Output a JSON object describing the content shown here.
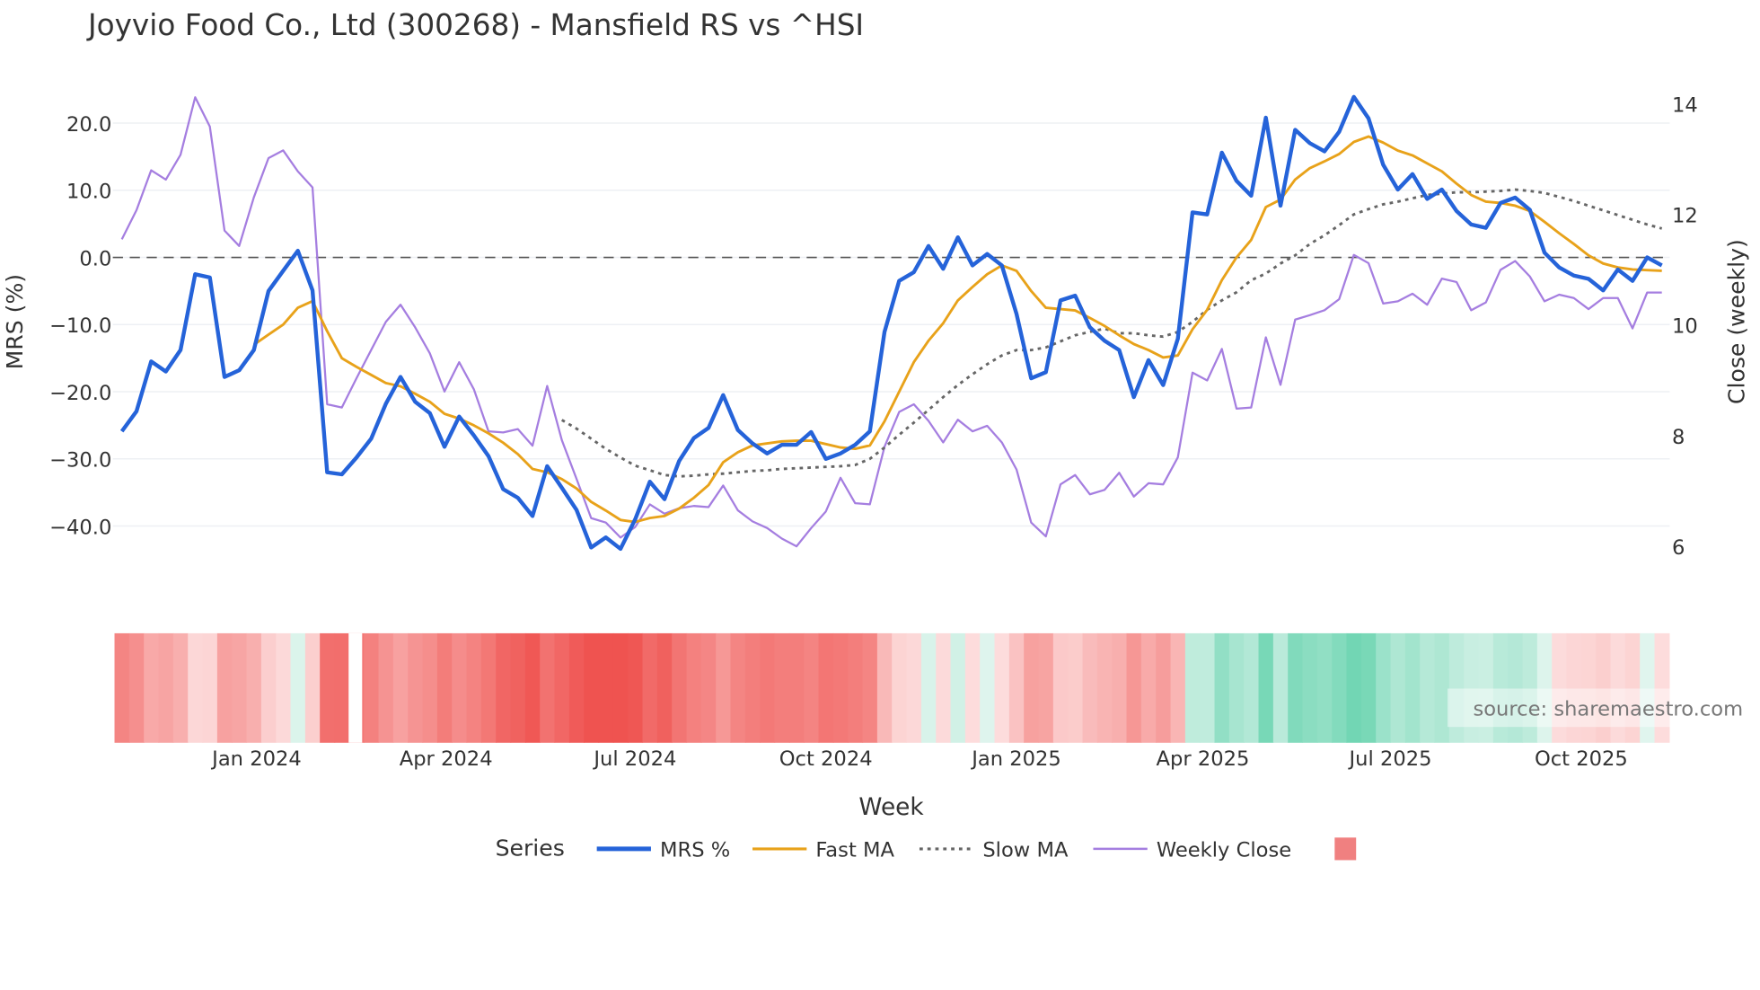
{
  "chart_data": {
    "type": "line",
    "title": "Joyvio Food Co., Ltd (300268) - Mansfield RS vs ^HSI",
    "xlabel": "Week",
    "ylabel_left": "MRS (%)",
    "ylabel_right": "Close (weekly)",
    "ylim_left": [
      -47,
      27
    ],
    "ylim_right": [
      5.4,
      14.6
    ],
    "yticks_left": [
      "20.0",
      "10.0",
      "0.0",
      "−10.0",
      "−20.0",
      "−30.0",
      "−40.0"
    ],
    "yticks_left_values": [
      20,
      10,
      0,
      -10,
      -20,
      -30,
      -40
    ],
    "yticks_right": [
      "14",
      "12",
      "10",
      "8",
      "6"
    ],
    "yticks_right_values": [
      14,
      12,
      10,
      8,
      6
    ],
    "x_ticks": [
      {
        "label": "Jan 2024",
        "week_index": 9.2
      },
      {
        "label": "Apr 2024",
        "week_index": 22.1
      },
      {
        "label": "Jul 2024",
        "week_index": 35
      },
      {
        "label": "Oct 2024",
        "week_index": 48
      },
      {
        "label": "Jan 2025",
        "week_index": 61
      },
      {
        "label": "Apr 2025",
        "week_index": 73.7
      },
      {
        "label": "Jul 2025",
        "week_index": 86.5
      },
      {
        "label": "Oct 2025",
        "week_index": 99.5
      }
    ],
    "zero_line": 0,
    "grid": true,
    "legend_title": "Series",
    "legend_position": "bottom",
    "series": [
      {
        "name": "MRS %",
        "color": "#2563d9",
        "axis": "left",
        "values": [
          -25.9,
          -22.9,
          -15.5,
          -17,
          -13.8,
          -2.5,
          -3,
          -17.8,
          -16.8,
          -13.8,
          -5,
          -2,
          1,
          -4.9,
          -32,
          -32.3,
          -29.8,
          -27,
          -21.8,
          -17.8,
          -21.5,
          -23.2,
          -28.2,
          -23.7,
          -26.5,
          -29.6,
          -34.5,
          -35.8,
          -38.5,
          -31.1,
          -34.3,
          -37.6,
          -43.2,
          -41.7,
          -43.4,
          -39,
          -33.4,
          -36,
          -30.3,
          -26.9,
          -25.4,
          -20.5,
          -25.7,
          -27.7,
          -29.2,
          -27.9,
          -27.9,
          -26,
          -30,
          -29.2,
          -27.9,
          -25.9,
          -11.1,
          -3.5,
          -2.2,
          1.7,
          -1.7,
          3,
          -1.2,
          0.5,
          -1.2,
          -8.4,
          -18,
          -17.1,
          -6.4,
          -5.7,
          -10.4,
          -12.4,
          -13.8,
          -20.8,
          -15.3,
          -19,
          -12.1,
          6.7,
          6.4,
          15.6,
          11.4,
          9.2,
          20.8,
          7.7,
          19,
          17,
          15.8,
          18.7,
          23.9,
          20.7,
          13.8,
          10.1,
          12.4,
          8.7,
          10.1,
          6.9,
          4.9,
          4.4,
          8.1,
          8.9,
          7.1,
          0.7,
          -1.5,
          -2.7,
          -3.2,
          -4.9,
          -1.8,
          -3.5,
          0,
          -1.2
        ]
      },
      {
        "name": "Fast MA",
        "color": "#e8a21a",
        "axis": "left",
        "values": [
          null,
          null,
          null,
          null,
          null,
          null,
          null,
          null,
          null,
          -13,
          -11.5,
          -10,
          -7.5,
          -6.5,
          -11,
          -15,
          -16.3,
          -17.5,
          -18.7,
          -19.2,
          -20.3,
          -21.5,
          -23.3,
          -24,
          -25,
          -26.2,
          -27.6,
          -29.3,
          -31.5,
          -32,
          -33,
          -34.4,
          -36.4,
          -37.7,
          -39.1,
          -39.4,
          -38.8,
          -38.5,
          -37.4,
          -35.8,
          -33.9,
          -30.5,
          -29,
          -28,
          -27.7,
          -27.4,
          -27.3,
          -27.3,
          -27.8,
          -28.3,
          -28.5,
          -28,
          -24.4,
          -20,
          -15.6,
          -12.4,
          -9.8,
          -6.4,
          -4.4,
          -2.5,
          -1.2,
          -2,
          -5,
          -7.5,
          -7.7,
          -7.9,
          -9,
          -10.2,
          -11.6,
          -12.9,
          -13.8,
          -14.9,
          -14.6,
          -10.7,
          -7.8,
          -3.4,
          0,
          2.6,
          7.5,
          8.6,
          11.6,
          13.3,
          14.3,
          15.4,
          17.2,
          18,
          17.1,
          15.9,
          15.2,
          14,
          12.8,
          11,
          9.3,
          8.3,
          8.1,
          7.7,
          6.9,
          5.3,
          3.6,
          2,
          0.3,
          -0.9,
          -1.5,
          -1.8,
          -1.9,
          -2
        ]
      },
      {
        "name": "Slow MA",
        "color": "#666666",
        "axis": "left",
        "dash": true,
        "values": [
          null,
          null,
          null,
          null,
          null,
          null,
          null,
          null,
          null,
          null,
          null,
          null,
          null,
          null,
          null,
          null,
          null,
          null,
          null,
          null,
          null,
          null,
          null,
          null,
          null,
          null,
          null,
          null,
          null,
          null,
          -24.2,
          -25.5,
          -27,
          -28.5,
          -29.8,
          -31,
          -31.7,
          -32.4,
          -32.6,
          -32.5,
          -32.3,
          -32.2,
          -32,
          -31.8,
          -31.7,
          -31.5,
          -31.4,
          -31.3,
          -31.2,
          -31.1,
          -30.9,
          -30,
          -28.3,
          -26.4,
          -24.6,
          -22.7,
          -20.8,
          -19,
          -17.4,
          -15.9,
          -14.6,
          -13.8,
          -13.8,
          -13.4,
          -12.5,
          -11.6,
          -11.1,
          -10.6,
          -11.3,
          -11.3,
          -11.6,
          -11.8,
          -11.1,
          -9.6,
          -7.8,
          -6.4,
          -5.2,
          -3.4,
          -2.4,
          -0.9,
          0.3,
          2,
          3.3,
          4.8,
          6.4,
          7.2,
          7.9,
          8.3,
          8.8,
          9.3,
          9.5,
          9.7,
          9.7,
          9.8,
          9.9,
          10.1,
          9.9,
          9.6,
          9,
          8.4,
          7.7,
          7,
          6.3,
          5.6,
          4.9,
          4.3
        ]
      },
      {
        "name": "Weekly Close",
        "color": "#a57ee0",
        "axis": "right",
        "values": [
          11.55,
          12.08,
          12.8,
          12.63,
          13.08,
          14.12,
          13.59,
          11.71,
          11.43,
          12.31,
          13.02,
          13.16,
          12.78,
          12.49,
          8.57,
          8.51,
          9.04,
          9.55,
          10.06,
          10.37,
          9.96,
          9.49,
          8.8,
          9.33,
          8.84,
          8.08,
          8.06,
          8.12,
          7.82,
          8.9,
          7.92,
          7.22,
          6.51,
          6.43,
          6.16,
          6.35,
          6.76,
          6.59,
          6.69,
          6.73,
          6.71,
          7.1,
          6.65,
          6.45,
          6.33,
          6.14,
          6.0,
          6.33,
          6.63,
          7.24,
          6.78,
          6.76,
          7.8,
          8.43,
          8.57,
          8.27,
          7.88,
          8.29,
          8.08,
          8.18,
          7.88,
          7.39,
          6.43,
          6.18,
          7.12,
          7.29,
          6.94,
          7.02,
          7.33,
          6.9,
          7.14,
          7.12,
          7.61,
          9.14,
          9.0,
          9.57,
          8.49,
          8.51,
          9.78,
          8.92,
          10.1,
          10.18,
          10.27,
          10.47,
          11.27,
          11.12,
          10.39,
          10.43,
          10.57,
          10.37,
          10.84,
          10.78,
          10.27,
          10.41,
          11.0,
          11.16,
          10.88,
          10.43,
          10.55,
          10.49,
          10.29,
          10.49,
          10.49,
          9.94,
          10.59,
          10.59
        ]
      }
    ],
    "heatmap": {
      "source": "MRS %",
      "negative_color": "#ef5350",
      "positive_color": "#72d6b4",
      "legend_swatch_color": "#f08080"
    },
    "watermark": "source: sharemaestro.com"
  }
}
